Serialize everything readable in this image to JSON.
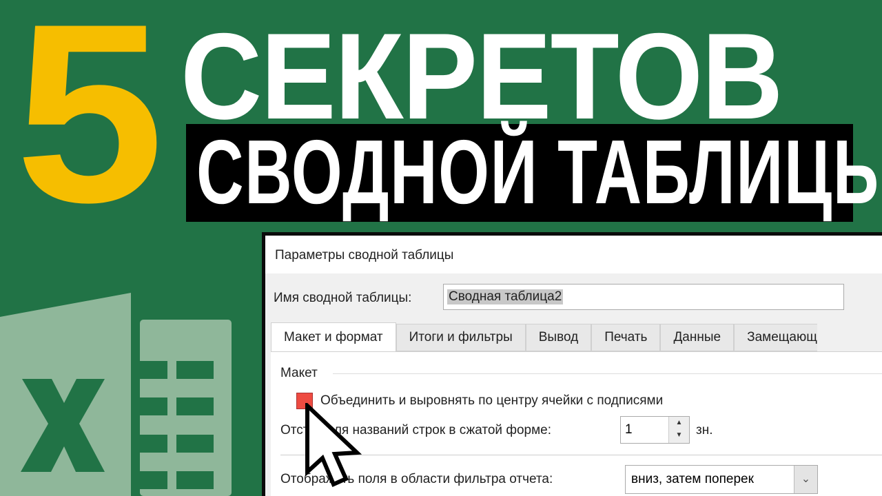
{
  "headline": {
    "number": "5",
    "line1": "СЕКРЕТОВ",
    "line2": "СВОДНОЙ ТАБЛИЦЫ"
  },
  "colors": {
    "background": "#217346",
    "number": "#f6be00",
    "checkbox": "#ee4b41"
  },
  "dialog": {
    "title": "Параметры сводной таблицы",
    "name_label": "Имя сводной таблицы:",
    "name_value": "Сводная таблица2",
    "tabs": [
      "Макет и формат",
      "Итоги и фильтры",
      "Вывод",
      "Печать",
      "Данные",
      "Замещающ"
    ],
    "group_label": "Макет",
    "merge_checkbox_label": "Объединить и выровнять по центру ячейки с подписями",
    "indent_label": "Отступ для названий строк в сжатой форме:",
    "indent_value": "1",
    "indent_unit": "зн.",
    "filter_label": "Отображать поля в области фильтра отчета:",
    "filter_value": "вниз, затем поперек"
  }
}
